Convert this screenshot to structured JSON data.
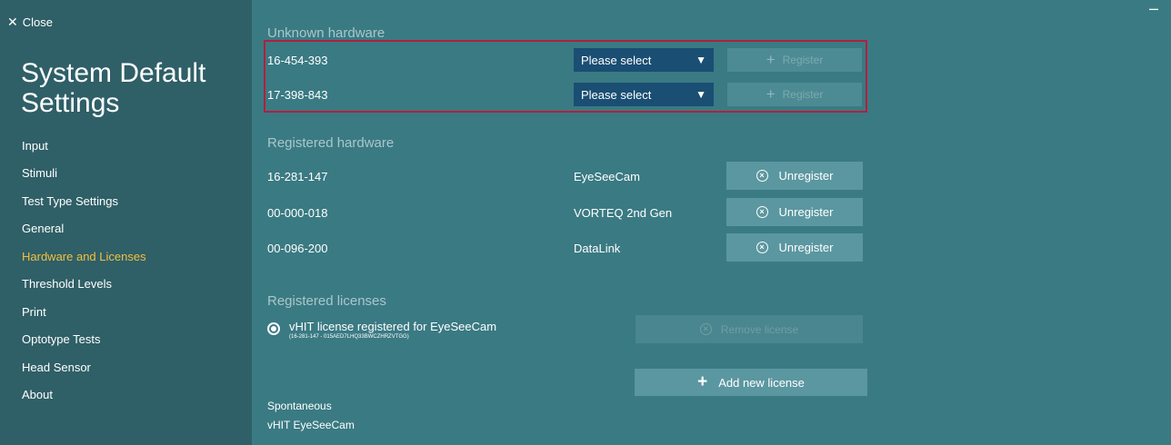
{
  "window": {
    "close_icon": "close-icon",
    "close_label": "Close",
    "minimize_label": "–",
    "title": "System Default Settings"
  },
  "sidebar": {
    "items": [
      {
        "label": "Input",
        "active": false
      },
      {
        "label": "Stimuli",
        "active": false
      },
      {
        "label": "Test Type Settings",
        "active": false
      },
      {
        "label": "General",
        "active": false
      },
      {
        "label": "Hardware and Licenses",
        "active": true
      },
      {
        "label": "Threshold Levels",
        "active": false
      },
      {
        "label": "Print",
        "active": false
      },
      {
        "label": "Optotype Tests",
        "active": false
      },
      {
        "label": "Head Sensor",
        "active": false
      },
      {
        "label": "About",
        "active": false
      }
    ],
    "active_color": "#f0c040"
  },
  "unknown_hardware": {
    "title": "Unknown hardware",
    "highlight_color": "#b21f3f",
    "rows": [
      {
        "id": "16-454-393",
        "select_value": "Please select",
        "register_label": "Register"
      },
      {
        "id": "17-398-843",
        "select_value": "Please select",
        "register_label": "Register"
      }
    ]
  },
  "registered_hardware": {
    "title": "Registered hardware",
    "rows": [
      {
        "id": "16-281-147",
        "name": "EyeSeeCam",
        "button_label": "Unregister"
      },
      {
        "id": "00-000-018",
        "name": "VORTEQ 2nd Gen",
        "button_label": "Unregister"
      },
      {
        "id": "00-096-200",
        "name": "DataLink",
        "button_label": "Unregister"
      }
    ]
  },
  "registered_licenses": {
    "title": "Registered licenses",
    "license": {
      "title": "vHIT license registered for EyeSeeCam",
      "detail": "(16-281-147 - 015AED7LHQ33BWCZHRZVTGG)"
    },
    "remove_label": "Remove license",
    "add_label": "Add new license"
  },
  "footer": {
    "lines": [
      "Spontaneous",
      "vHIT EyeSeeCam"
    ]
  },
  "colors": {
    "main_bg": "#3a7a83",
    "sidebar_bg": "#2f5f67",
    "select_bg": "#1a4e73",
    "button_bg": "#5b97a0"
  }
}
